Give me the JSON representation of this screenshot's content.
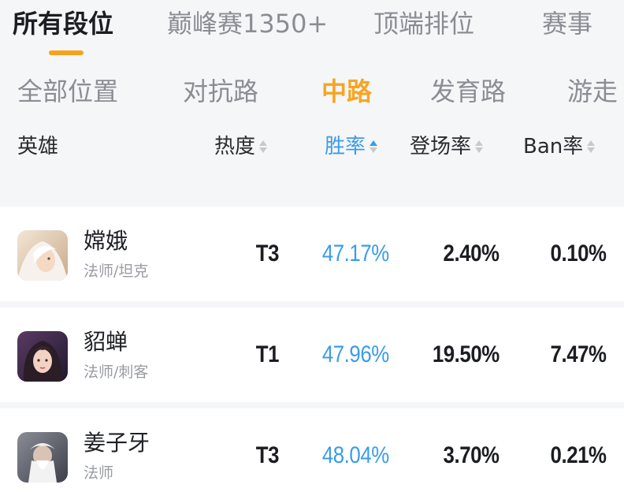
{
  "rank_tabs": [
    {
      "label": "所有段位",
      "active": true
    },
    {
      "label": "巅峰赛1350+",
      "active": false
    },
    {
      "label": "顶端排位",
      "active": false
    },
    {
      "label": "赛事",
      "active": false
    }
  ],
  "position_tabs": [
    {
      "label": "全部位置",
      "active": false
    },
    {
      "label": "对抗路",
      "active": false
    },
    {
      "label": "中路",
      "active": true
    },
    {
      "label": "发育路",
      "active": false
    },
    {
      "label": "游走",
      "active": false
    }
  ],
  "columns": {
    "hero": "英雄",
    "heat": "热度",
    "win_rate": "胜率",
    "pick_rate": "登场率",
    "ban_rate": "Ban率"
  },
  "accent_colors": {
    "orange": "#f5a623",
    "blue": "#3b9ce8"
  },
  "heroes": [
    {
      "name": "嫦娥",
      "role": "法师/坦克",
      "tier": "T3",
      "win_rate": "47.17%",
      "pick_rate": "2.40%",
      "ban_rate": "0.10%",
      "avatar_icon": "hero-avatar-icon"
    },
    {
      "name": "貂蝉",
      "role": "法师/刺客",
      "tier": "T1",
      "win_rate": "47.96%",
      "pick_rate": "19.50%",
      "ban_rate": "7.47%",
      "avatar_icon": "hero-avatar-icon"
    },
    {
      "name": "姜子牙",
      "role": "法师",
      "tier": "T3",
      "win_rate": "48.04%",
      "pick_rate": "3.70%",
      "ban_rate": "0.21%",
      "avatar_icon": "hero-avatar-icon"
    }
  ]
}
